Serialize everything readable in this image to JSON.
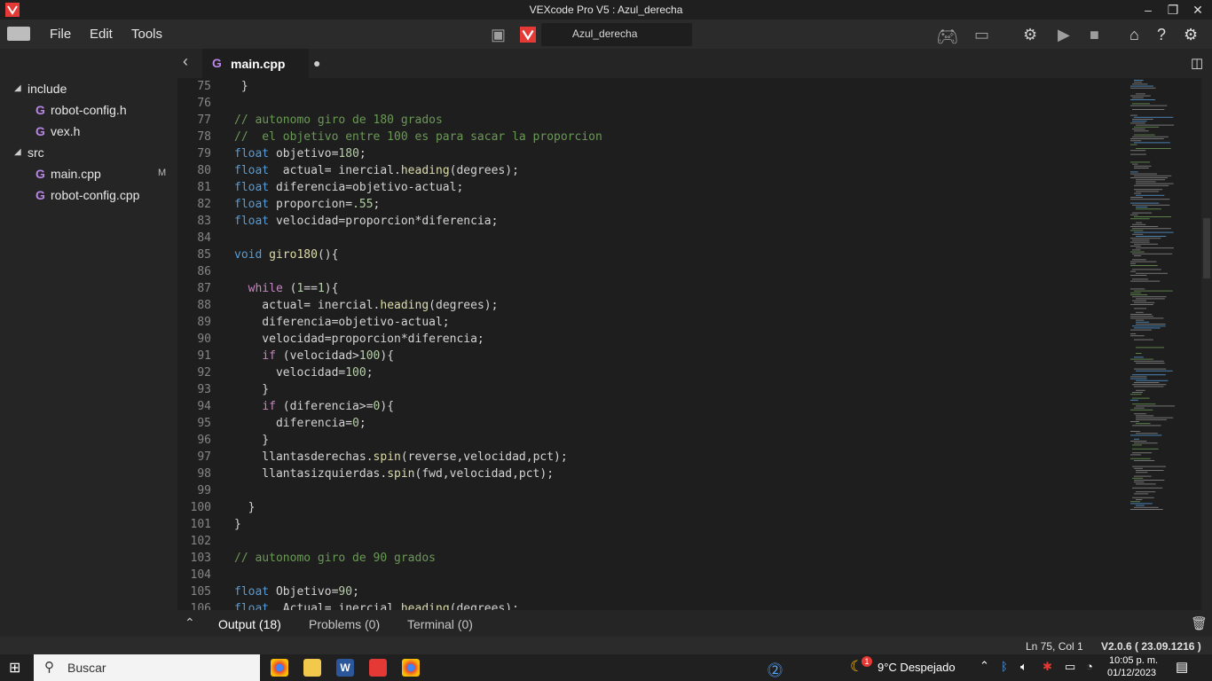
{
  "window": {
    "title": "VEXcode Pro V5 : Azul_derecha"
  },
  "menu": {
    "file": "File",
    "edit": "Edit",
    "tools": "Tools",
    "project_name": "Azul_derecha"
  },
  "sidebar": {
    "items": [
      {
        "label": "include",
        "type": "folder"
      },
      {
        "label": "robot-config.h",
        "type": "file"
      },
      {
        "label": "vex.h",
        "type": "file"
      },
      {
        "label": "src",
        "type": "folder"
      },
      {
        "label": "main.cpp",
        "type": "file",
        "badge": "M"
      },
      {
        "label": "robot-config.cpp",
        "type": "file"
      }
    ]
  },
  "tab": {
    "label": "main.cpp"
  },
  "code": {
    "lines": [
      {
        "n": "75",
        "t": " }"
      },
      {
        "n": "76",
        "t": ""
      },
      {
        "n": "77",
        "t": "// autonomo giro de 180 grados"
      },
      {
        "n": "78",
        "t": "//  el objetivo entre 100 es para sacar la proporcion"
      },
      {
        "n": "79",
        "t": "float objetivo=180;"
      },
      {
        "n": "80",
        "t": "float  actual= inercial.heading(degrees);"
      },
      {
        "n": "81",
        "t": "float diferencia=objetivo-actual;"
      },
      {
        "n": "82",
        "t": "float proporcion=.55;"
      },
      {
        "n": "83",
        "t": "float velocidad=proporcion*diferencia;"
      },
      {
        "n": "84",
        "t": ""
      },
      {
        "n": "85",
        "t": "void giro180(){"
      },
      {
        "n": "86",
        "t": ""
      },
      {
        "n": "87",
        "t": "  while (1==1){"
      },
      {
        "n": "88",
        "t": "    actual= inercial.heading(degrees);"
      },
      {
        "n": "89",
        "t": "    diferencia=objetivo-actual;"
      },
      {
        "n": "90",
        "t": "    velocidad=proporcion*diferencia;"
      },
      {
        "n": "91",
        "t": "    if (velocidad>100){"
      },
      {
        "n": "92",
        "t": "      velocidad=100;"
      },
      {
        "n": "93",
        "t": "    }"
      },
      {
        "n": "94",
        "t": "    if (diferencia>=0){"
      },
      {
        "n": "95",
        "t": "      diferencia=0;"
      },
      {
        "n": "96",
        "t": "    }"
      },
      {
        "n": "97",
        "t": "    llantasderechas.spin(reverse,velocidad,pct);"
      },
      {
        "n": "98",
        "t": "    llantasizquierdas.spin(fwd,velocidad,pct);"
      },
      {
        "n": "99",
        "t": ""
      },
      {
        "n": "100",
        "t": "  }"
      },
      {
        "n": "101",
        "t": "}"
      },
      {
        "n": "102",
        "t": ""
      },
      {
        "n": "103",
        "t": "// autonomo giro de 90 grados"
      },
      {
        "n": "104",
        "t": ""
      },
      {
        "n": "105",
        "t": "float Objetivo=90;"
      },
      {
        "n": "106",
        "t": "float  Actual= inercial.heading(degrees);"
      }
    ]
  },
  "panel": {
    "output": "Output (18)",
    "problems": "Problems (0)",
    "terminal": "Terminal (0)"
  },
  "status": {
    "position": "Ln 75, Col 1",
    "version": "V2.0.6 ( 23.09.1216 )"
  },
  "taskbar": {
    "search": "Buscar",
    "weather": "9°C  Despejado",
    "time": "10:05 p. m.",
    "date": "01/12/2023",
    "notif_count": "1"
  },
  "colors": {
    "accent": "#e53935",
    "keyword": "#569cd6",
    "comment": "#6a9955",
    "function": "#dcdcaa",
    "number": "#b5cea8"
  }
}
